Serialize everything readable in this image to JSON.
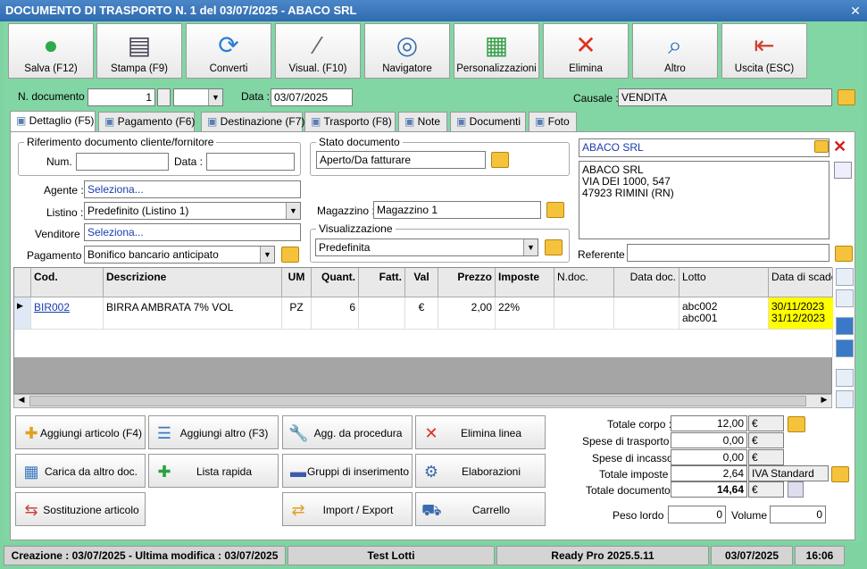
{
  "window": {
    "title": "DOCUMENTO DI TRASPORTO N. 1 del 03/07/2025 - ABACO SRL"
  },
  "toolbar": [
    {
      "label": "Salva (F12)",
      "icon": "check-icon"
    },
    {
      "label": "Stampa (F9)",
      "icon": "printer-icon"
    },
    {
      "label": "Converti",
      "icon": "convert-icon"
    },
    {
      "label": "Visual. (F10)",
      "icon": "wand-icon"
    },
    {
      "label": "Navigatore",
      "icon": "compass-icon"
    },
    {
      "label": "Personalizzazioni",
      "icon": "grid-icon"
    },
    {
      "label": "Elimina",
      "icon": "delete-x-icon"
    },
    {
      "label": "Altro",
      "icon": "magnifier-icon"
    },
    {
      "label": "Uscita (ESC)",
      "icon": "exit-door-icon"
    }
  ],
  "header": {
    "ndoc_label": "N. documento :",
    "ndoc_value": "1",
    "data_label": "Data :",
    "data_value": "03/07/2025",
    "causale_label": "Causale :",
    "causale_value": "VENDITA"
  },
  "tabs": [
    "Dettaglio (F5)",
    "Pagamento (F6)",
    "Destinazione (F7)",
    "Trasporto (F8)",
    "Note",
    "Documenti",
    "Foto"
  ],
  "form": {
    "rif_title": "Riferimento documento cliente/fornitore",
    "num_label": "Num. :",
    "data_label": "Data :",
    "stato_title": "Stato documento",
    "stato_value": "Aperto/Da fatturare",
    "agente_label": "Agente :",
    "agente_value": "Seleziona...",
    "listino_label": "Listino :",
    "listino_value": "Predefinito (Listino 1)",
    "venditore_label": "Venditore :",
    "venditore_value": "Seleziona...",
    "pagamento_label": "Pagamento :",
    "pagamento_value": "Bonifico bancario anticipato",
    "magazzino_label": "Magazzino :",
    "magazzino_value": "Magazzino 1",
    "visual_title": "Visualizzazione",
    "visual_value": "Predefinita",
    "cliente_name": "ABACO SRL",
    "cliente_addr1": "ABACO SRL",
    "cliente_addr2": "VIA DEI 1000, 547",
    "cliente_addr3": "47923 RIMINI (RN)",
    "referente_label": "Referente"
  },
  "grid": {
    "headers": [
      "Cod.",
      "Descrizione",
      "UM",
      "Quant.",
      "Fatt.",
      "Val",
      "Prezzo",
      "Imposte",
      "N.doc.",
      "Data doc.",
      "Lotto",
      "Data di scaden"
    ],
    "row": {
      "cod": "BIR002",
      "desc": "BIRRA AMBRATA 7% VOL",
      "um": "PZ",
      "quant": "6",
      "fatt": "",
      "val": "€",
      "prezzo": "2,00",
      "imposte": "22%",
      "ndoc": "",
      "datadoc": "",
      "lotto1": "abc002",
      "lotto2": "abc001",
      "scad1": "30/11/2023",
      "scad2": "31/12/2023"
    }
  },
  "actions": [
    {
      "label": "Aggiungi articolo (F4)",
      "icon": "add-article-icon"
    },
    {
      "label": "Aggiungi altro (F3)",
      "icon": "add-other-icon"
    },
    {
      "label": "Agg. da procedura",
      "icon": "wrench-icon"
    },
    {
      "label": "Elimina linea",
      "icon": "delete-line-icon"
    },
    {
      "label": "Carica da altro doc.",
      "icon": "load-doc-icon"
    },
    {
      "label": "Lista rapida",
      "icon": "quick-list-icon"
    },
    {
      "label": "Gruppi di inserimento",
      "icon": "groups-icon"
    },
    {
      "label": "Elaborazioni",
      "icon": "gear-doc-icon"
    },
    {
      "label": "Sostituzione articolo",
      "icon": "replace-icon"
    },
    {
      "label": "Import / Export",
      "icon": "import-export-icon"
    },
    {
      "label": "Carrello",
      "icon": "cart-icon"
    }
  ],
  "totals": {
    "corpo_label": "Totale corpo :",
    "corpo": "12,00",
    "cur": "€",
    "trasporto_label": "Spese di trasporto :",
    "trasporto": "0,00",
    "incasso_label": "Spese di incasso :",
    "incasso": "0,00",
    "imposte_label": "Totale imposte :",
    "imposte": "2,64",
    "iva": "IVA Standard",
    "documento_label": "Totale documento :",
    "documento": "14,64",
    "peso_label": "Peso lordo :",
    "peso": "0",
    "volume_label": "Volume :",
    "volume": "0"
  },
  "status": {
    "creazione": "Creazione : 03/07/2025 - Ultima modifica : 03/07/2025",
    "user": "Test Lotti",
    "version": "Ready Pro 2025.5.11",
    "date": "03/07/2025",
    "time": "16:06"
  }
}
